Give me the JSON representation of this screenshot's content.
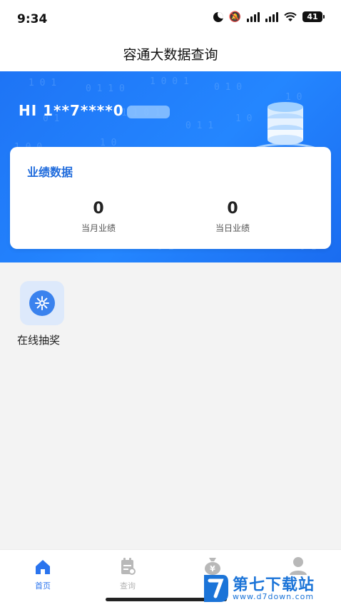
{
  "status_bar": {
    "time": "9:34",
    "battery": "41"
  },
  "header": {
    "title": "容通大数据查询"
  },
  "banner": {
    "greeting": "HI 1**7****0"
  },
  "performance_card": {
    "title": "业绩数据",
    "stats": [
      {
        "value": "0",
        "label": "当月业绩"
      },
      {
        "value": "0",
        "label": "当日业绩"
      }
    ]
  },
  "features": [
    {
      "label": "在线抽奖",
      "icon": "lottery-icon"
    }
  ],
  "tabbar": {
    "tabs": [
      {
        "label": "首页",
        "icon": "home-icon",
        "active": true
      },
      {
        "label": "查询",
        "icon": "query-icon"
      },
      {
        "label": "",
        "icon": "money-bag-icon"
      },
      {
        "label": "",
        "icon": "user-icon"
      }
    ]
  },
  "watermark": {
    "title": "第七下载站",
    "url": "www.d7down.com"
  },
  "colors": {
    "primary": "#2486ff",
    "card_title": "#1f6bdc",
    "tab_active": "#2a74ee"
  }
}
